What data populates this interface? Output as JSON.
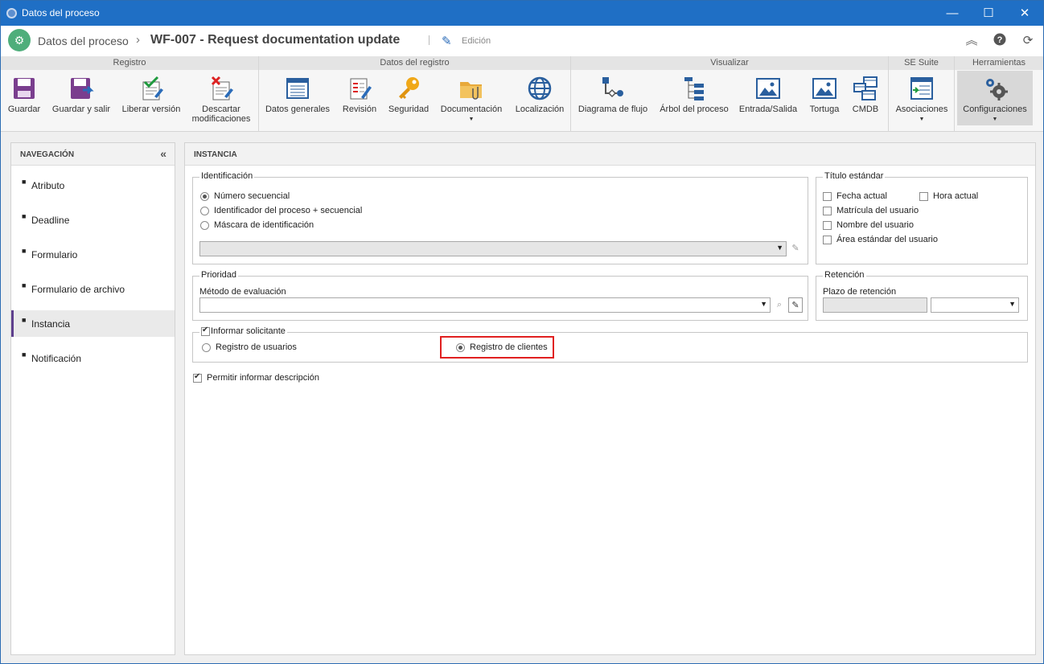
{
  "window": {
    "title": "Datos del proceso",
    "minimize": "—",
    "maximize": "☐",
    "close": "✕"
  },
  "header": {
    "breadcrumb_root": "Datos del proceso",
    "breadcrumb_sep": "›",
    "title": "WF-007 - Request documentation update",
    "mode": "Edición"
  },
  "ribbon": {
    "groups": [
      "Registro",
      "Datos del registro",
      "Visualizar",
      "SE Suite",
      "Herramientas"
    ],
    "buttons": {
      "guardar": "Guardar",
      "guardar_salir": "Guardar y salir",
      "liberar": "Liberar versión",
      "descartar_1": "Descartar",
      "descartar_2": "modificaciones",
      "datos_generales": "Datos generales",
      "revision": "Revisión",
      "seguridad": "Seguridad",
      "documentacion": "Documentación",
      "localizacion": "Localización",
      "diagrama": "Diagrama de flujo",
      "arbol": "Árbol del proceso",
      "entrada_salida": "Entrada/Salida",
      "tortuga": "Tortuga",
      "cmdb": "CMDB",
      "asociaciones": "Asociaciones",
      "configuraciones": "Configuraciones"
    }
  },
  "nav": {
    "title": "NAVEGACIÓN",
    "items": [
      "Atributo",
      "Deadline",
      "Formulario",
      "Formulario de archivo",
      "Instancia",
      "Notificación"
    ],
    "selected": "Instancia"
  },
  "main": {
    "title": "INSTANCIA",
    "identificacion": {
      "legend": "Identificación",
      "options": [
        "Número secuencial",
        "Identificador del proceso + secuencial",
        "Máscara de identificación"
      ],
      "selected": "Número secuencial"
    },
    "titulo": {
      "legend": "Título estándar",
      "options": [
        "Fecha actual",
        "Hora actual",
        "Matrícula del usuario",
        "Nombre del usuario",
        "Área estándar del usuario"
      ]
    },
    "prioridad": {
      "legend": "Prioridad",
      "label": "Método de evaluación"
    },
    "retencion": {
      "legend": "Retención",
      "label": "Plazo de retención"
    },
    "solicitante": {
      "legend": "Informar solicitante",
      "checked": true,
      "options": [
        "Registro de usuarios",
        "Registro de clientes"
      ],
      "selected": "Registro de clientes"
    },
    "descripcion": {
      "label": "Permitir informar descripción",
      "checked": true
    }
  }
}
